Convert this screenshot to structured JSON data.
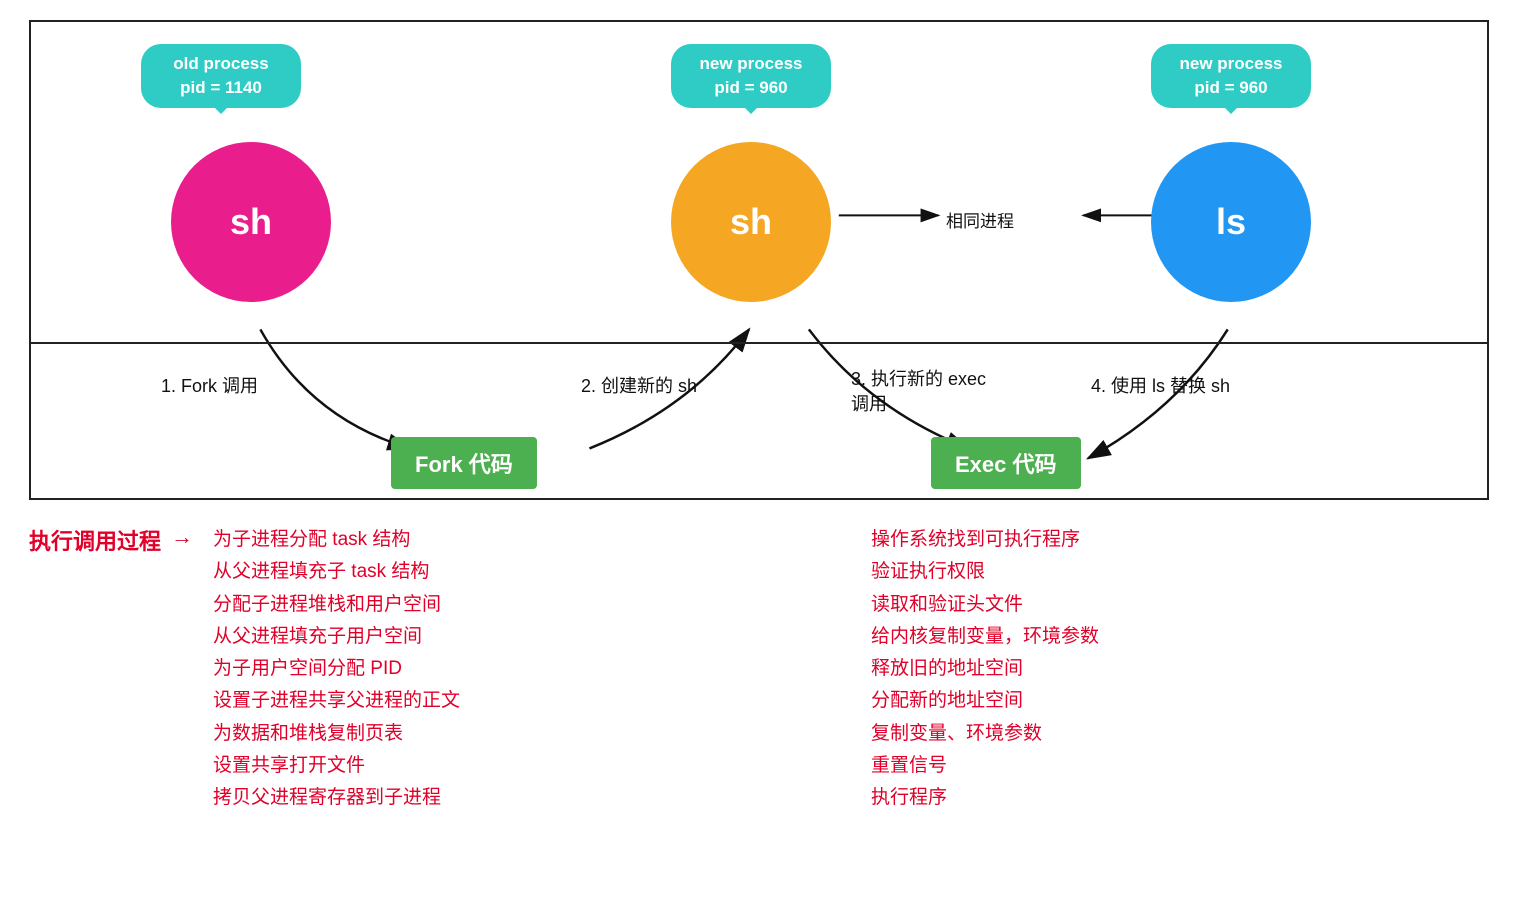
{
  "diagram": {
    "bubble_old": {
      "line1": "old process",
      "line2": "pid = 1140"
    },
    "bubble_new1": {
      "line1": "new process",
      "line2": "pid = 960"
    },
    "bubble_new2": {
      "line1": "new process",
      "line2": "pid = 960"
    },
    "circle_sh_pink": "sh",
    "circle_sh_orange": "sh",
    "circle_ls_blue": "ls",
    "fork_box": "Fork 代码",
    "exec_box": "Exec 代码",
    "step1": "1. Fork 调用",
    "step2": "2. 创建新的 sh",
    "step3": "3. 执行新的 exec 调用",
    "step4": "4. 使用 ls 替换 sh",
    "same_process_label": "相同进程"
  },
  "bottom": {
    "exec_call_label": "执行调用过程",
    "fork_items": [
      "为子进程分配 task 结构",
      "从父进程填充子 task 结构",
      "分配子进程堆栈和用户空间",
      "从父进程填充子用户空间",
      "为子用户空间分配 PID",
      "设置子进程共享父进程的正文",
      "为数据和堆栈复制页表",
      "设置共享打开文件",
      "拷贝父进程寄存器到子进程"
    ],
    "exec_items": [
      "操作系统找到可执行程序",
      "验证执行权限",
      "读取和验证头文件",
      "给内核复制变量，环境参数",
      "释放旧的地址空间",
      "分配新的地址空间",
      "复制变量、环境参数",
      "重置信号",
      "执行程序"
    ]
  }
}
